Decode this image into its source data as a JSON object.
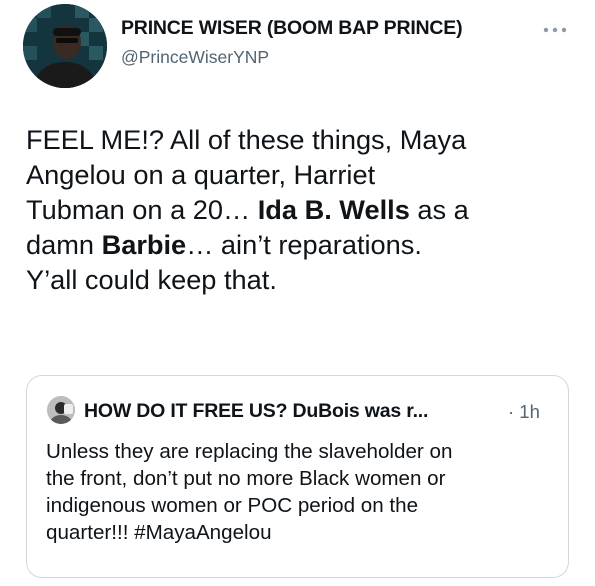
{
  "tweet": {
    "author": {
      "display_name": "PRINCE WISER (BOOM BAP PRINCE)",
      "handle": "@PrinceWiserYNP",
      "avatar_icon": "user-avatar"
    },
    "text_lines": [
      [
        {
          "t": "FEEL ME!? All of these things, Maya",
          "b": false
        }
      ],
      [
        {
          "t": "Angelou on a quarter, Harriet",
          "b": false
        }
      ],
      [
        {
          "t": "Tubman on a 20… ",
          "b": false
        },
        {
          "t": "Ida B. Wells",
          "b": true
        },
        {
          "t": " as a",
          "b": false
        }
      ],
      [
        {
          "t": "damn ",
          "b": false
        },
        {
          "t": "Barbie",
          "b": true
        },
        {
          "t": "… ain’t reparations.",
          "b": false
        }
      ],
      [
        {
          "t": "Y’all could keep that.",
          "b": false
        }
      ]
    ]
  },
  "quoted_tweet": {
    "author_name": "HOW DO IT FREE US? DuBois was r...",
    "meta": "· 1h",
    "text_lines": [
      "Unless they are replacing the slaveholder on",
      "the front, don’t put no more Black women or",
      "indigenous women or POC period on the",
      "quarter!!! #MayaAngelou"
    ]
  },
  "colors": {
    "text_primary": "#0f1419",
    "text_secondary": "#536471",
    "border": "#cfd9de"
  }
}
